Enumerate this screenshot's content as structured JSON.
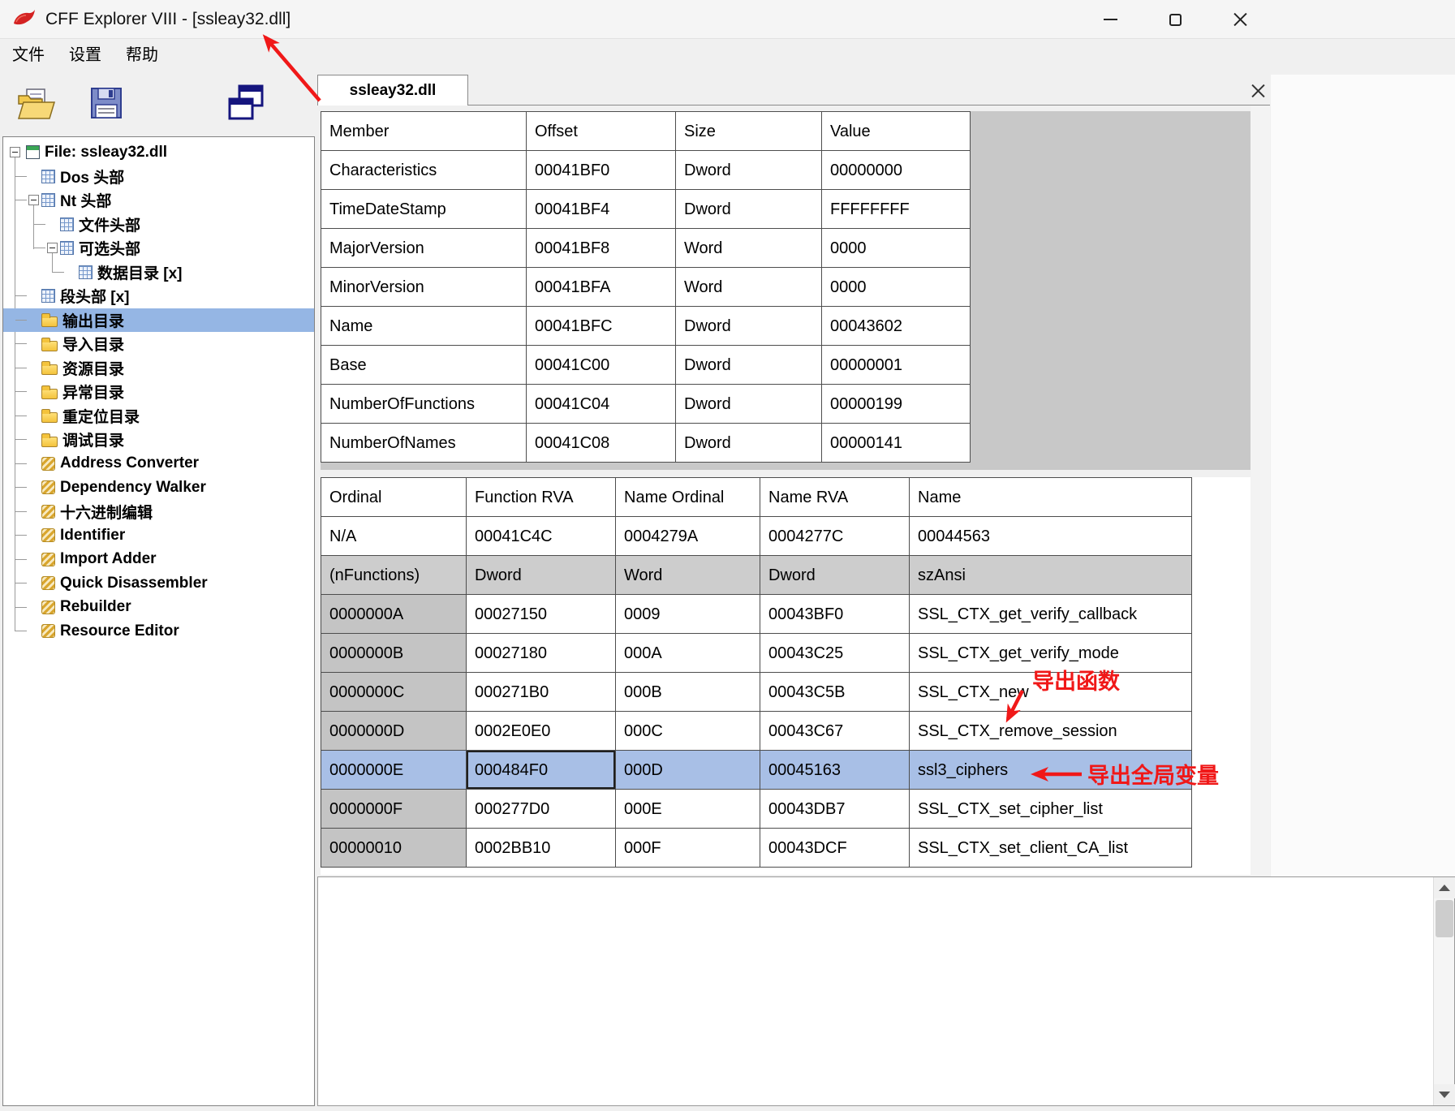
{
  "window": {
    "title": "CFF Explorer VIII - [ssleay32.dll]"
  },
  "menu": {
    "items": [
      {
        "label": "文件"
      },
      {
        "label": "设置"
      },
      {
        "label": "帮助"
      }
    ]
  },
  "tab": {
    "label": "ssleay32.dll"
  },
  "tree": {
    "items": [
      {
        "label": "File: ssleay32.dll"
      },
      {
        "label": "Dos 头部"
      },
      {
        "label": "Nt 头部"
      },
      {
        "label": "文件头部"
      },
      {
        "label": "可选头部"
      },
      {
        "label": "数据目录 [x]"
      },
      {
        "label": "段头部 [x]"
      },
      {
        "label": "输出目录"
      },
      {
        "label": "导入目录"
      },
      {
        "label": "资源目录"
      },
      {
        "label": "异常目录"
      },
      {
        "label": "重定位目录"
      },
      {
        "label": "调试目录"
      },
      {
        "label": "Address Converter"
      },
      {
        "label": "Dependency Walker"
      },
      {
        "label": "十六进制编辑"
      },
      {
        "label": "Identifier"
      },
      {
        "label": "Import Adder"
      },
      {
        "label": "Quick Disassembler"
      },
      {
        "label": "Rebuilder"
      },
      {
        "label": "Resource Editor"
      }
    ],
    "selected": "输出目录"
  },
  "member_table": {
    "headers": [
      "Member",
      "Offset",
      "Size",
      "Value"
    ],
    "rows": [
      [
        "Characteristics",
        "00041BF0",
        "Dword",
        "00000000"
      ],
      [
        "TimeDateStamp",
        "00041BF4",
        "Dword",
        "FFFFFFFF"
      ],
      [
        "MajorVersion",
        "00041BF8",
        "Word",
        "0000"
      ],
      [
        "MinorVersion",
        "00041BFA",
        "Word",
        "0000"
      ],
      [
        "Name",
        "00041BFC",
        "Dword",
        "00043602"
      ],
      [
        "Base",
        "00041C00",
        "Dword",
        "00000001"
      ],
      [
        "NumberOfFunctions",
        "00041C04",
        "Dword",
        "00000199"
      ],
      [
        "NumberOfNames",
        "00041C08",
        "Dword",
        "00000141"
      ]
    ]
  },
  "export_table": {
    "headers": [
      "Ordinal",
      "Function RVA",
      "Name Ordinal",
      "Name RVA",
      "Name"
    ],
    "rows": [
      [
        "N/A",
        "00041C4C",
        "0004279A",
        "0004277C",
        "00044563"
      ],
      [
        "(nFunctions)",
        "Dword",
        "Word",
        "Dword",
        "szAnsi"
      ],
      [
        "0000000A",
        "00027150",
        "0009",
        "00043BF0",
        "SSL_CTX_get_verify_callback"
      ],
      [
        "0000000B",
        "00027180",
        "000A",
        "00043C25",
        "SSL_CTX_get_verify_mode"
      ],
      [
        "0000000C",
        "000271B0",
        "000B",
        "00043C5B",
        "SSL_CTX_new"
      ],
      [
        "0000000D",
        "0002E0E0",
        "000C",
        "00043C67",
        "SSL_CTX_remove_session"
      ],
      [
        "0000000E",
        "000484F0",
        "000D",
        "00045163",
        "ssl3_ciphers"
      ],
      [
        "0000000F",
        "000277D0",
        "000E",
        "00043DB7",
        "SSL_CTX_set_cipher_list"
      ],
      [
        "00000010",
        "0002BB10",
        "000F",
        "00043DCF",
        "SSL_CTX_set_client_CA_list"
      ]
    ],
    "selected_row_index": 6,
    "selected_row_name": "ssl3_ciphers"
  },
  "annotations": {
    "labels": [
      {
        "text": "导出函数"
      },
      {
        "text": "导出全局变量"
      }
    ]
  },
  "icons": {
    "app-icon": "red-swirl",
    "minimize-icon": "dash",
    "maximize-icon": "square",
    "close-icon": "x",
    "open-folder-icon": "folder-open",
    "save-icon": "floppy",
    "cascade-windows-icon": "overlapping-windows",
    "tab-close-icon": "x",
    "file-icon": "mini-window",
    "header-icon": "grid-doc",
    "folder-icon": "yellow-folder",
    "tool-icon": "gold-coil",
    "scroll-up-icon": "triangle-up",
    "scroll-down-icon": "triangle-down"
  },
  "colors": {
    "selection": "#a8bfe6",
    "tree-selection": "#95b6e4",
    "annotation": "#f01818",
    "grid": "#4d4d4d",
    "cell-gray": "#c4c4c4",
    "subhead-gray": "#cdcdcd",
    "backdrop-gray": "#c8c8c8"
  }
}
